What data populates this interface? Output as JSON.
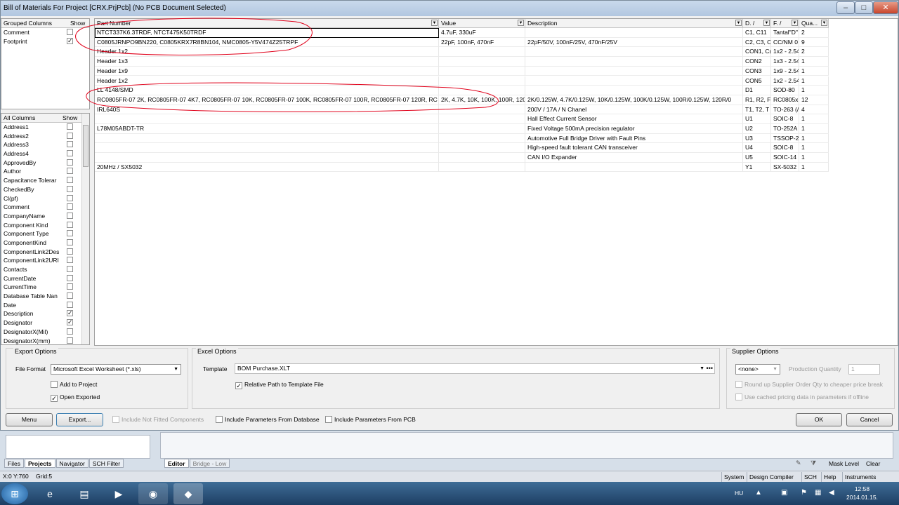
{
  "window": {
    "title": "Bill of Materials For Project [CRX.PrjPcb] (No PCB Document Selected)"
  },
  "grouped_columns": {
    "header": "Grouped Columns",
    "show_header": "Show",
    "items": [
      {
        "label": "Comment",
        "checked": false
      },
      {
        "label": "Footprint",
        "checked": true
      }
    ]
  },
  "all_columns": {
    "header": "All Columns",
    "show_header": "Show",
    "items": [
      {
        "label": "Address1",
        "checked": false
      },
      {
        "label": "Address2",
        "checked": false
      },
      {
        "label": "Address3",
        "checked": false
      },
      {
        "label": "Address4",
        "checked": false
      },
      {
        "label": "ApprovedBy",
        "checked": false
      },
      {
        "label": "Author",
        "checked": false
      },
      {
        "label": "Capacitance Tolerar",
        "checked": false
      },
      {
        "label": "CheckedBy",
        "checked": false
      },
      {
        "label": "Cl(pf)",
        "checked": false
      },
      {
        "label": "Comment",
        "checked": false
      },
      {
        "label": "CompanyName",
        "checked": false
      },
      {
        "label": "Component Kind",
        "checked": false
      },
      {
        "label": "Component Type",
        "checked": false
      },
      {
        "label": "ComponentKind",
        "checked": false
      },
      {
        "label": "ComponentLink2Des",
        "checked": false
      },
      {
        "label": "ComponentLink2URI",
        "checked": false
      },
      {
        "label": "Contacts",
        "checked": false
      },
      {
        "label": "CurrentDate",
        "checked": false
      },
      {
        "label": "CurrentTime",
        "checked": false
      },
      {
        "label": "Database Table Nan",
        "checked": false
      },
      {
        "label": "Date",
        "checked": false
      },
      {
        "label": "Description",
        "checked": true
      },
      {
        "label": "Designator",
        "checked": true
      },
      {
        "label": "DesignatorX(Mil)",
        "checked": false
      },
      {
        "label": "DesignatorX(mm)",
        "checked": false
      }
    ]
  },
  "bom": {
    "columns": [
      "Part Number",
      "Value",
      "Description",
      "D. /",
      "F. /",
      "Qua..."
    ],
    "rows": [
      [
        "NTCT337K6.3TRDF, NTCT475K50TRDF",
        "4.7uF, 330uF",
        "",
        "C1, C11",
        "Tantal\"D\"",
        "2"
      ],
      [
        "C0805JRNPO9BN220, C0805KRX7R8BN104, NMC0805-Y5V474Z25TRPF",
        "22pF, 100nF, 470nF",
        "22pF/50V, 100nF/25V, 470nF/25V",
        "C2, C3, C",
        "CC/NM 0",
        "9"
      ],
      [
        "Header 1x2",
        "",
        "",
        "CON1, C(",
        "1x2 - 2.54",
        "2"
      ],
      [
        "Header 1x3",
        "",
        "",
        "CON2",
        "1x3 - 2.54",
        "1"
      ],
      [
        "Header 1x9",
        "",
        "",
        "CON3",
        "1x9 - 2.54",
        "1"
      ],
      [
        "Header 1x2",
        "",
        "",
        "CON5",
        "1x2 - 2.54",
        "1"
      ],
      [
        "LL 4148/SMD",
        "",
        "",
        "D1",
        "SOD-80",
        "1"
      ],
      [
        "RC0805FR-07 2K, RC0805FR-07 4K7, RC0805FR-07 10K, RC0805FR-07 100K, RC0805FR-07 100R, RC0805FR-07 120R, RC",
        "2K, 4.7K, 10K, 100K, 100R, 120",
        "2K/0.125W, 4.7K/0.125W, 10K/0.125W, 100K/0.125W, 100R/0.125W, 120R/0",
        "R1, R2, F",
        "RC0805x",
        "12"
      ],
      [
        "IRL640S",
        "",
        "200V / 17A / N Chanel",
        "T1, T2, T",
        "TO-263 (/",
        "4"
      ],
      [
        "",
        "",
        "Hall Effect Current Sensor",
        "U1",
        "SOIC-8",
        "1"
      ],
      [
        "L78M05ABDT-TR",
        "",
        "Fixed Voltage 500mA precision regulator",
        "U2",
        "TO-252A",
        "1"
      ],
      [
        "",
        "",
        "Automotive Full Bridge Driver with Fault Pins",
        "U3",
        "TSSOP-2",
        "1"
      ],
      [
        "",
        "",
        "High-speed fault tolerant CAN transceiver",
        "U4",
        "SOIC-8",
        "1"
      ],
      [
        "",
        "",
        "CAN I/O Expander",
        "U5",
        "SOIC-14",
        "1"
      ],
      [
        "20MHz / SX5032",
        "",
        "",
        "Y1",
        "SX-5032",
        "1"
      ]
    ]
  },
  "export_options": {
    "label": "Export Options",
    "file_format_label": "File Format",
    "file_format": "Microsoft Excel Worksheet (*.xls)",
    "add_to_project": "Add to Project",
    "add_to_project_checked": false,
    "open_exported": "Open Exported",
    "open_exported_checked": true
  },
  "excel_options": {
    "label": "Excel Options",
    "template_label": "Template",
    "template": "BOM Purchase.XLT",
    "relative_path": "Relative Path to Template File",
    "relative_path_checked": true
  },
  "supplier_options": {
    "label": "Supplier Options",
    "supplier": "<none>",
    "production_quantity_label": "Production Quantity",
    "production_quantity": "1",
    "round_up": "Round up Supplier Order Qty to cheaper price break",
    "use_cached": "Use cached pricing data in parameters if offline"
  },
  "footer": {
    "menu": "Menu",
    "export": "Export...",
    "include_not_fitted": "Include Not Fitted Components",
    "include_db": "Include Parameters From Database",
    "include_pcb": "Include Parameters From PCB",
    "ok": "OK",
    "cancel": "Cancel"
  },
  "ide": {
    "panel_tabs": [
      "Files",
      "Projects",
      "Navigator",
      "SCH Filter"
    ],
    "active_panel_tab": "Projects",
    "editor_tabs": [
      "Editor",
      "Bridge - Low"
    ],
    "mask_level": "Mask Level",
    "clear": "Clear"
  },
  "statusbar": {
    "coords": "X:0 Y:760",
    "grid": "Grid:5",
    "right_items": [
      "System",
      "Design Compiler",
      "SCH",
      "Help",
      "Instruments"
    ]
  },
  "taskbar": {
    "lang": "HU",
    "time": "12:58",
    "date": "2014.01.15."
  },
  "annotation_color": "#e0001a"
}
